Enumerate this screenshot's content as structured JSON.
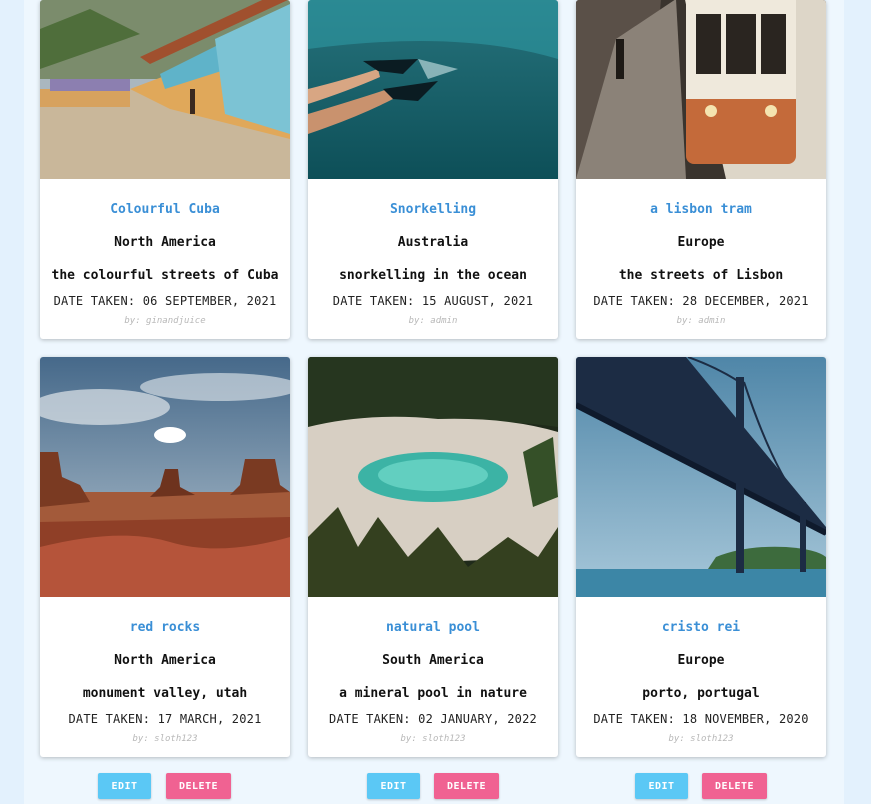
{
  "cards": [
    {
      "title": "Colourful Cuba",
      "region": "North America",
      "description": "the colourful streets of Cuba",
      "date": "DATE TAKEN: 06 SEPTEMBER, 2021",
      "author": "by: ginandjuice"
    },
    {
      "title": "Snorkelling",
      "region": "Australia",
      "description": "snorkelling in the ocean",
      "date": "DATE TAKEN: 15 AUGUST, 2021",
      "author": "by: admin"
    },
    {
      "title": "a lisbon tram",
      "region": "Europe",
      "description": "the streets of Lisbon",
      "date": "DATE TAKEN: 28 DECEMBER, 2021",
      "author": "by: admin"
    },
    {
      "title": "red rocks",
      "region": "North America",
      "description": "monument valley, utah",
      "date": "DATE TAKEN: 17 MARCH, 2021",
      "author": "by: sloth123"
    },
    {
      "title": "natural pool",
      "region": "South America",
      "description": "a mineral pool in nature",
      "date": "DATE TAKEN: 02 JANUARY, 2022",
      "author": "by: sloth123"
    },
    {
      "title": "cristo rei",
      "region": "Europe",
      "description": "porto, portugal",
      "date": "DATE TAKEN: 18 NOVEMBER, 2020",
      "author": "by: sloth123"
    }
  ],
  "actions": {
    "edit_label": "EDIT",
    "delete_label": "DELETE"
  },
  "colors": {
    "title": "#3a8fd6",
    "edit": "#5bc8f5",
    "delete": "#f06292",
    "background": "#e3f1fd"
  }
}
